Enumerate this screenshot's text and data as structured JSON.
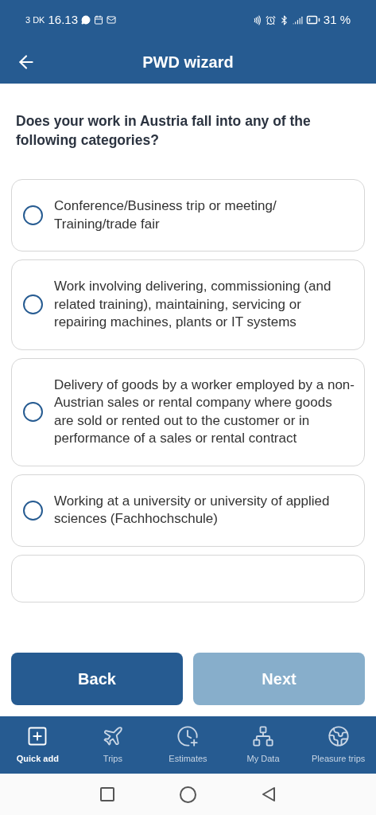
{
  "status_bar": {
    "left_label": "3 DK",
    "time": "16.13",
    "battery": "31 %"
  },
  "header": {
    "title": "PWD wizard"
  },
  "question": "Does your work in Austria fall into any of the following categories?",
  "options": [
    {
      "label": "Conference/Business trip or meeting/ Training/trade fair",
      "selected": false
    },
    {
      "label": "Work involving delivering, commissioning (and related training), maintaining, servicing or repairing machines, plants or IT systems",
      "selected": false
    },
    {
      "label": "Delivery of goods by a worker employed by a non-Austrian sales or rental company where goods are sold or rented out to the customer or in performance of a sales or rental contract",
      "selected": false
    },
    {
      "label": "Working at a university or university of applied sciences (Fachhochschule)",
      "selected": false
    }
  ],
  "buttons": [
    {
      "label": "Back",
      "disabled": false
    },
    {
      "label": "Next",
      "disabled": true
    }
  ],
  "nav": [
    {
      "label": "Quick add",
      "selected": true
    },
    {
      "label": "Trips",
      "selected": false
    },
    {
      "label": "Estimates",
      "selected": false
    },
    {
      "label": "My Data",
      "selected": false
    },
    {
      "label": "Pleasure trips",
      "selected": false
    }
  ]
}
